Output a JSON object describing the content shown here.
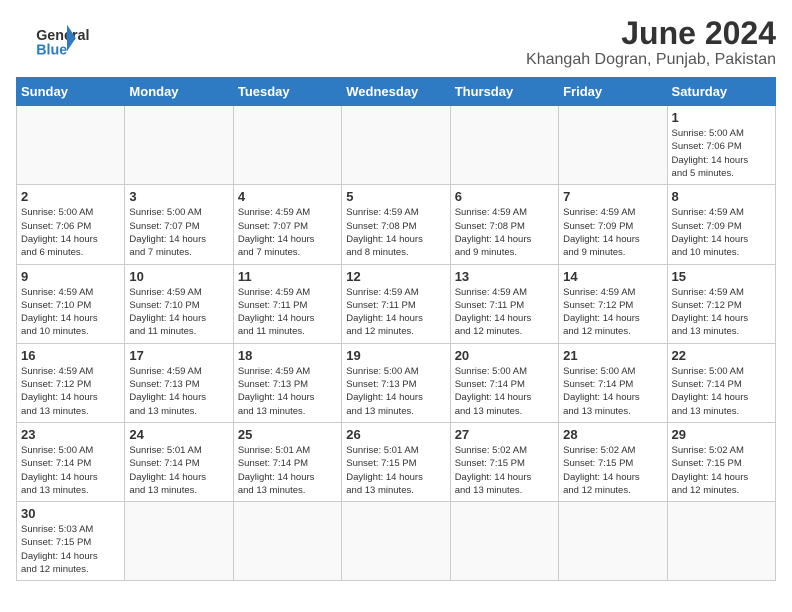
{
  "header": {
    "logo_general": "General",
    "logo_blue": "Blue",
    "month_title": "June 2024",
    "location": "Khangah Dogran, Punjab, Pakistan"
  },
  "days_of_week": [
    "Sunday",
    "Monday",
    "Tuesday",
    "Wednesday",
    "Thursday",
    "Friday",
    "Saturday"
  ],
  "weeks": [
    [
      {
        "day": "",
        "info": ""
      },
      {
        "day": "",
        "info": ""
      },
      {
        "day": "",
        "info": ""
      },
      {
        "day": "",
        "info": ""
      },
      {
        "day": "",
        "info": ""
      },
      {
        "day": "",
        "info": ""
      },
      {
        "day": "1",
        "info": "Sunrise: 5:00 AM\nSunset: 7:06 PM\nDaylight: 14 hours\nand 5 minutes."
      }
    ],
    [
      {
        "day": "2",
        "info": "Sunrise: 5:00 AM\nSunset: 7:06 PM\nDaylight: 14 hours\nand 6 minutes."
      },
      {
        "day": "3",
        "info": "Sunrise: 5:00 AM\nSunset: 7:07 PM\nDaylight: 14 hours\nand 7 minutes."
      },
      {
        "day": "4",
        "info": "Sunrise: 4:59 AM\nSunset: 7:07 PM\nDaylight: 14 hours\nand 7 minutes."
      },
      {
        "day": "5",
        "info": "Sunrise: 4:59 AM\nSunset: 7:08 PM\nDaylight: 14 hours\nand 8 minutes."
      },
      {
        "day": "6",
        "info": "Sunrise: 4:59 AM\nSunset: 7:08 PM\nDaylight: 14 hours\nand 9 minutes."
      },
      {
        "day": "7",
        "info": "Sunrise: 4:59 AM\nSunset: 7:09 PM\nDaylight: 14 hours\nand 9 minutes."
      },
      {
        "day": "8",
        "info": "Sunrise: 4:59 AM\nSunset: 7:09 PM\nDaylight: 14 hours\nand 10 minutes."
      }
    ],
    [
      {
        "day": "9",
        "info": "Sunrise: 4:59 AM\nSunset: 7:10 PM\nDaylight: 14 hours\nand 10 minutes."
      },
      {
        "day": "10",
        "info": "Sunrise: 4:59 AM\nSunset: 7:10 PM\nDaylight: 14 hours\nand 11 minutes."
      },
      {
        "day": "11",
        "info": "Sunrise: 4:59 AM\nSunset: 7:11 PM\nDaylight: 14 hours\nand 11 minutes."
      },
      {
        "day": "12",
        "info": "Sunrise: 4:59 AM\nSunset: 7:11 PM\nDaylight: 14 hours\nand 12 minutes."
      },
      {
        "day": "13",
        "info": "Sunrise: 4:59 AM\nSunset: 7:11 PM\nDaylight: 14 hours\nand 12 minutes."
      },
      {
        "day": "14",
        "info": "Sunrise: 4:59 AM\nSunset: 7:12 PM\nDaylight: 14 hours\nand 12 minutes."
      },
      {
        "day": "15",
        "info": "Sunrise: 4:59 AM\nSunset: 7:12 PM\nDaylight: 14 hours\nand 13 minutes."
      }
    ],
    [
      {
        "day": "16",
        "info": "Sunrise: 4:59 AM\nSunset: 7:12 PM\nDaylight: 14 hours\nand 13 minutes."
      },
      {
        "day": "17",
        "info": "Sunrise: 4:59 AM\nSunset: 7:13 PM\nDaylight: 14 hours\nand 13 minutes."
      },
      {
        "day": "18",
        "info": "Sunrise: 4:59 AM\nSunset: 7:13 PM\nDaylight: 14 hours\nand 13 minutes."
      },
      {
        "day": "19",
        "info": "Sunrise: 5:00 AM\nSunset: 7:13 PM\nDaylight: 14 hours\nand 13 minutes."
      },
      {
        "day": "20",
        "info": "Sunrise: 5:00 AM\nSunset: 7:14 PM\nDaylight: 14 hours\nand 13 minutes."
      },
      {
        "day": "21",
        "info": "Sunrise: 5:00 AM\nSunset: 7:14 PM\nDaylight: 14 hours\nand 13 minutes."
      },
      {
        "day": "22",
        "info": "Sunrise: 5:00 AM\nSunset: 7:14 PM\nDaylight: 14 hours\nand 13 minutes."
      }
    ],
    [
      {
        "day": "23",
        "info": "Sunrise: 5:00 AM\nSunset: 7:14 PM\nDaylight: 14 hours\nand 13 minutes."
      },
      {
        "day": "24",
        "info": "Sunrise: 5:01 AM\nSunset: 7:14 PM\nDaylight: 14 hours\nand 13 minutes."
      },
      {
        "day": "25",
        "info": "Sunrise: 5:01 AM\nSunset: 7:14 PM\nDaylight: 14 hours\nand 13 minutes."
      },
      {
        "day": "26",
        "info": "Sunrise: 5:01 AM\nSunset: 7:15 PM\nDaylight: 14 hours\nand 13 minutes."
      },
      {
        "day": "27",
        "info": "Sunrise: 5:02 AM\nSunset: 7:15 PM\nDaylight: 14 hours\nand 13 minutes."
      },
      {
        "day": "28",
        "info": "Sunrise: 5:02 AM\nSunset: 7:15 PM\nDaylight: 14 hours\nand 12 minutes."
      },
      {
        "day": "29",
        "info": "Sunrise: 5:02 AM\nSunset: 7:15 PM\nDaylight: 14 hours\nand 12 minutes."
      }
    ],
    [
      {
        "day": "30",
        "info": "Sunrise: 5:03 AM\nSunset: 7:15 PM\nDaylight: 14 hours\nand 12 minutes."
      },
      {
        "day": "",
        "info": ""
      },
      {
        "day": "",
        "info": ""
      },
      {
        "day": "",
        "info": ""
      },
      {
        "day": "",
        "info": ""
      },
      {
        "day": "",
        "info": ""
      },
      {
        "day": "",
        "info": ""
      }
    ]
  ]
}
